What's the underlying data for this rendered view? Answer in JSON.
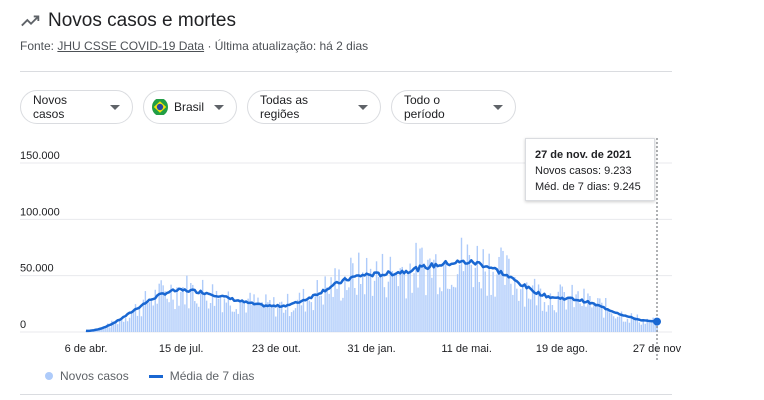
{
  "header": {
    "title": "Novos casos e mortes",
    "source_prefix": "Fonte:",
    "source_link": "JHU CSSE COVID-19 Data",
    "updated": "· Última atualização: há 2 dias"
  },
  "filters": {
    "metric": "Novos casos",
    "country": "Brasil",
    "region": "Todas as regiões",
    "period": "Todo o período"
  },
  "tooltip": {
    "date": "27 de nov. de 2021",
    "cases_line": "Novos casos: 9.233",
    "avg_line": "Méd. de 7 dias: 9.245"
  },
  "legend": {
    "cases": "Novos casos",
    "avg": "Média de 7 dias"
  },
  "colors": {
    "bars": "#aecbfa",
    "avg_line": "#1967d2",
    "grid": "#e8eaed"
  },
  "chart_data": {
    "type": "bar",
    "title": "",
    "xlabel": "",
    "ylabel": "",
    "ylim": [
      0,
      150000
    ],
    "y_ticks": [
      "0",
      "50.000",
      "100.000",
      "150.000"
    ],
    "x_ticks": [
      "6 de abr.",
      "15 de jul.",
      "23 de out.",
      "31 de jan.",
      "11 de mai.",
      "19 de ago.",
      "27 de nov"
    ],
    "grid": true,
    "legend_position": "bottom-left",
    "series": [
      {
        "name": "Média de 7 dias",
        "points": [
          [
            "6 de abr.",
            1000
          ],
          [
            "15 de jul.",
            37000
          ],
          [
            "23 de out.",
            23000
          ],
          [
            "31 de jan.",
            51000
          ],
          [
            "11 de mai.",
            62000
          ],
          [
            "19 de ago.",
            30000
          ],
          [
            "27 de nov",
            9245
          ]
        ]
      }
    ],
    "highlight": {
      "label": "27 de nov. de 2021",
      "new_cases": 9233,
      "avg_7_days": 9245
    }
  }
}
